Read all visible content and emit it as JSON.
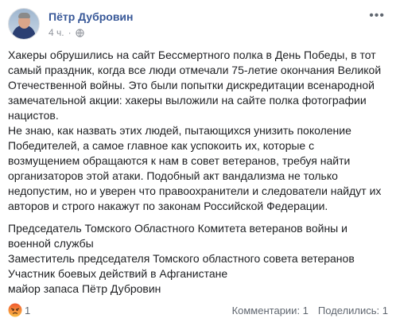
{
  "author": {
    "name": "Пётр Дубровин",
    "time": "4 ч.",
    "separator": "·"
  },
  "post": {
    "paragraphs": [
      "Хакеры обрушились на сайт Бессмертного полка в День Победы, в тот самый праздник, когда все люди отмечали 75-летие окончания Великой Отечественной войны. Это были попытки дискредитации всенародной замечательной акции: хакеры выложили на сайте полка фотографии нацистов.",
      "Не знаю, как назвать этих людей, пытающихся унизить поколение Победителей, а самое главное как успокоить их, которые с возмущением обращаются к нам в совет ветеранов, требуя найти организаторов этой атаки. Подобный акт вандализма не только недопустим, но и уверен что правоохранители и следователи найдут их авторов и строго накажут по законам Российской Федерации."
    ],
    "signature": [
      "Председатель Томского Областного Комитета ветеранов войны и военной службы",
      "Заместитель председателя Томского областного совета ветеранов",
      "Участник боевых действий в Афганистане",
      "майор запаса Пётр Дубровин"
    ]
  },
  "footer": {
    "reaction_count": "1",
    "comments": "Комментарии: 1",
    "shares": "Поделились: 1"
  },
  "icons": {
    "privacy": "globe-icon",
    "options": "more-horizontal-icon",
    "reaction": "angry-reaction-icon"
  },
  "colors": {
    "author_link": "#385898",
    "meta_text": "#90949c",
    "reaction": "#f0582f"
  }
}
